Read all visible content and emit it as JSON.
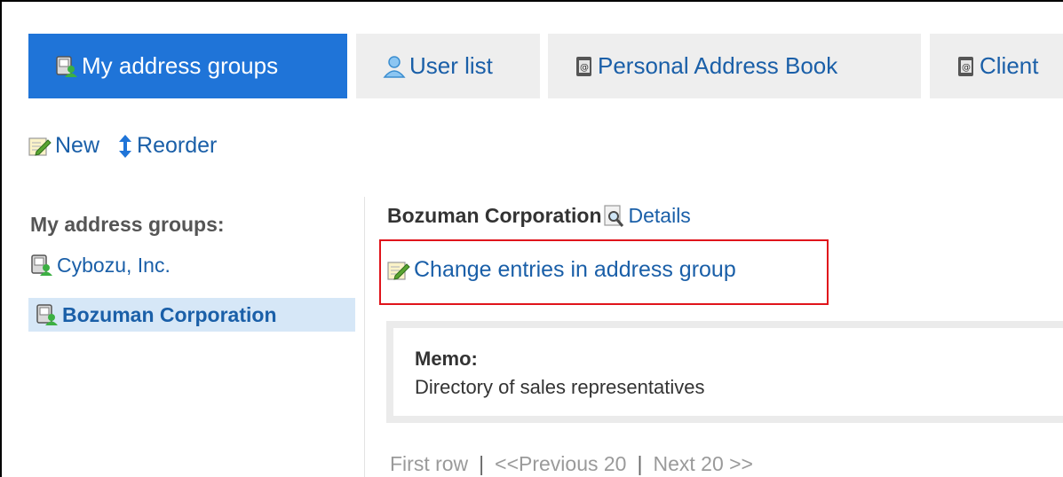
{
  "tabs": [
    {
      "label": "My address groups",
      "icon": "address-group-icon",
      "active": true
    },
    {
      "label": "User list",
      "icon": "user-icon",
      "active": false
    },
    {
      "label": "Personal Address Book",
      "icon": "address-book-icon",
      "active": false
    },
    {
      "label": "Client",
      "icon": "address-book-icon",
      "active": false
    }
  ],
  "toolbar": {
    "new_label": "New",
    "reorder_label": "Reorder"
  },
  "sidebar": {
    "title": "My address groups:",
    "items": [
      {
        "label": "Cybozu, Inc.",
        "selected": false
      },
      {
        "label": "Bozuman Corporation",
        "selected": true
      }
    ]
  },
  "content": {
    "group_name": "Bozuman Corporation",
    "details_label": "Details",
    "change_entries_label": "Change entries in address group",
    "memo_label": "Memo:",
    "memo_text": "Directory of sales representatives"
  },
  "pager": {
    "first": "First row",
    "separator": "|",
    "previous": "<<Previous 20",
    "next": "Next 20 >>"
  },
  "colors": {
    "active_tab": "#1f74d8",
    "link": "#1a5fa8",
    "highlight_box": "#e0141b",
    "selected_item_bg": "#d6e7f7"
  }
}
